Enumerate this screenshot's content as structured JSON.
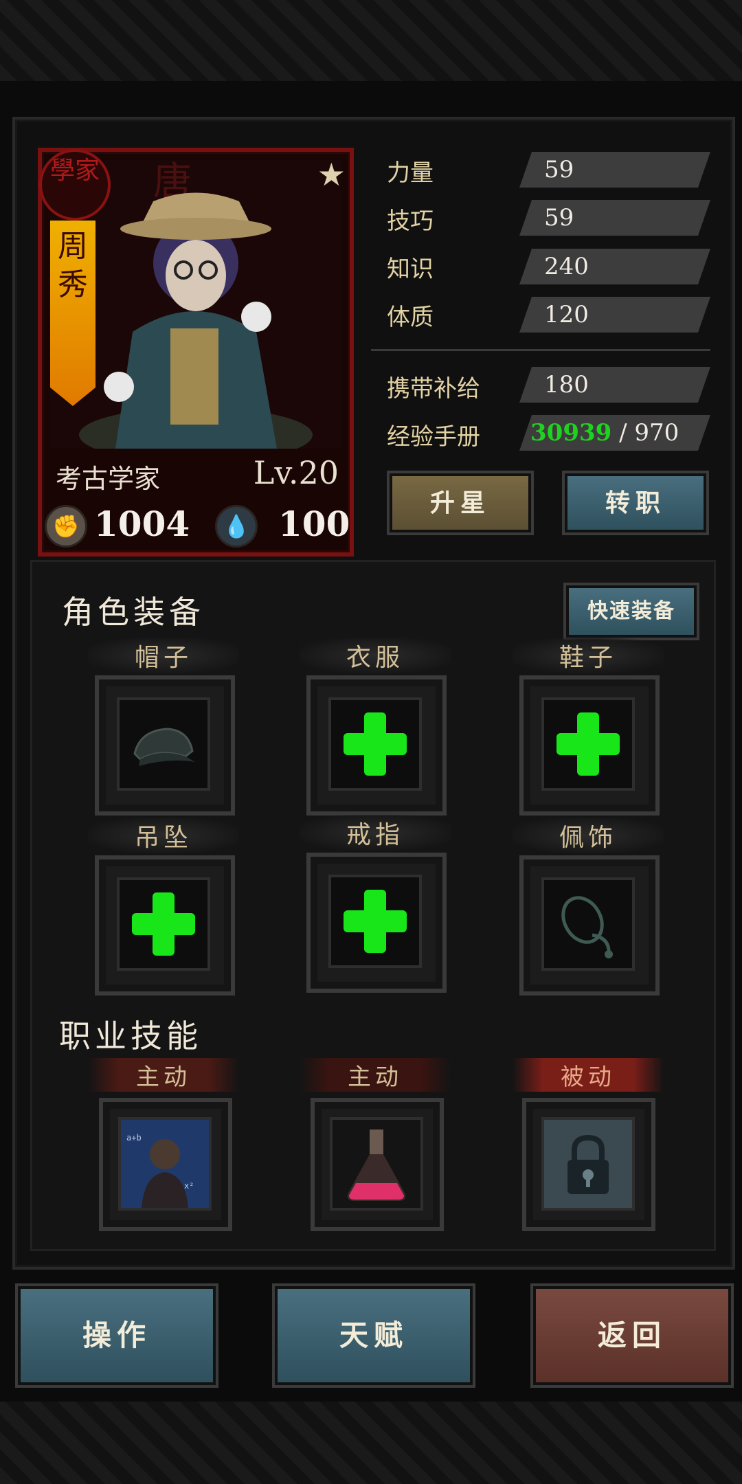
{
  "character": {
    "seal": "學家",
    "name_chars": [
      "周",
      "秀"
    ],
    "class_name": "考古学家",
    "level": "Lv.20",
    "power": "1004",
    "spirit": "100"
  },
  "stats": [
    {
      "label": "力量",
      "value": "59"
    },
    {
      "label": "技巧",
      "value": "59"
    },
    {
      "label": "知识",
      "value": "240"
    },
    {
      "label": "体质",
      "value": "120"
    }
  ],
  "supply": {
    "label": "携带补给",
    "value": "180"
  },
  "exp": {
    "label": "经验手册",
    "current": "30939",
    "separator": "/",
    "required": "970",
    "current_color": "#1fd21f"
  },
  "buttons": {
    "upgrade_star": "升星",
    "change_job": "转职",
    "quick_equip": "快速装备"
  },
  "equipment": {
    "title": "角色装备",
    "slots": [
      {
        "label": "帽子",
        "state": "item",
        "icon": "hat-icon"
      },
      {
        "label": "衣服",
        "state": "empty",
        "icon": "add-plus-icon"
      },
      {
        "label": "鞋子",
        "state": "empty",
        "icon": "add-plus-icon"
      },
      {
        "label": "吊坠",
        "state": "empty",
        "icon": "add-plus-icon"
      },
      {
        "label": "戒指",
        "state": "empty",
        "icon": "add-plus-icon"
      },
      {
        "label": "佩饰",
        "state": "item",
        "icon": "accessory-icon"
      }
    ]
  },
  "skills": {
    "title": "职业技能",
    "items": [
      {
        "type": "主动",
        "icon": "scholar-portrait-icon",
        "tag_color": "#d4c098"
      },
      {
        "type": "主动",
        "icon": "potion-flask-icon",
        "tag_color": "#d4c098"
      },
      {
        "type": "被动",
        "icon": "padlock-icon",
        "tag_color": "#e8a888"
      }
    ]
  },
  "bottom_nav": {
    "operate": "操作",
    "talent": "天赋",
    "back": "返回"
  },
  "colors": {
    "accent_green": "#19e619",
    "frame_red": "#7a1010",
    "banner_orange": "#e07a00"
  }
}
